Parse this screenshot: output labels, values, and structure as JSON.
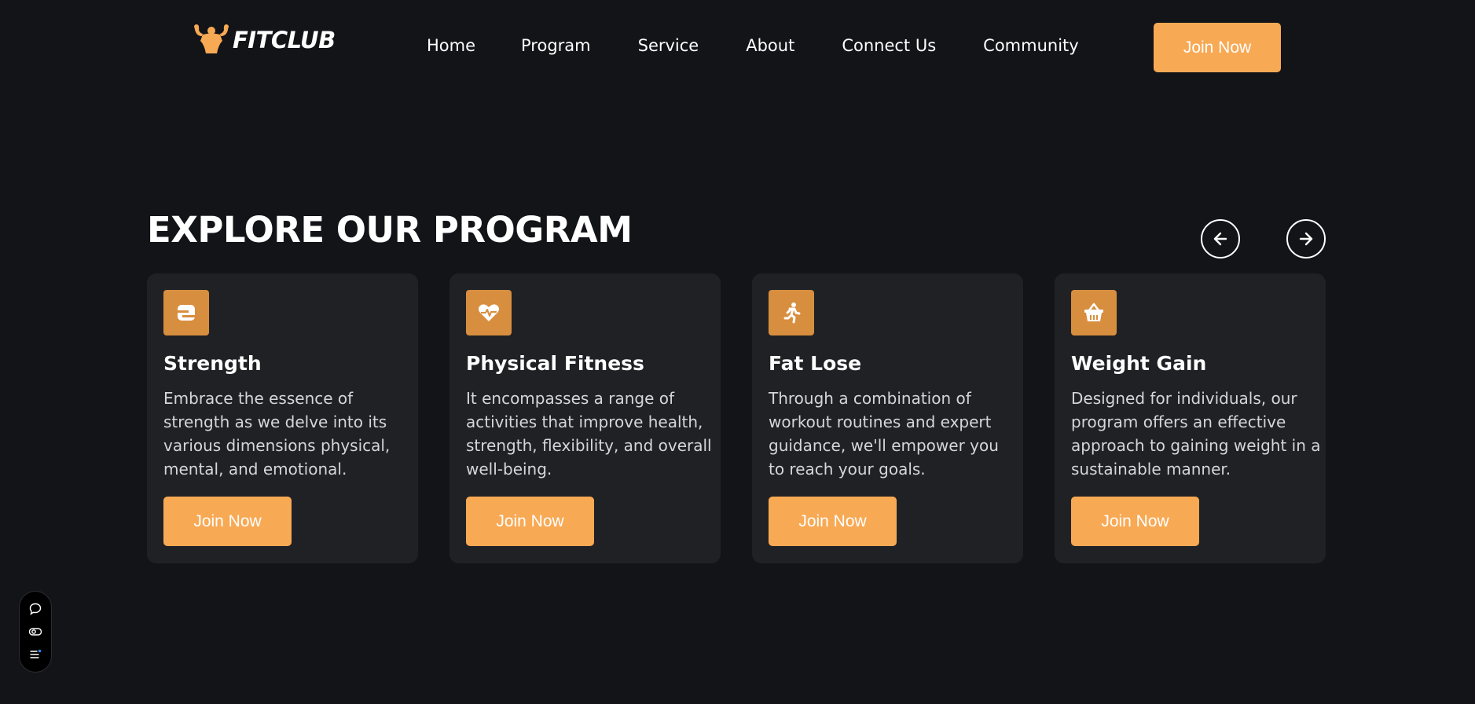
{
  "brand": {
    "logo_text": "FITCLUB",
    "accent_color": "#f8a954",
    "icon_bg_color": "#d78e3f",
    "logo_icon": "flexing-bodybuilder-icon"
  },
  "nav": {
    "items": [
      {
        "label": "Home"
      },
      {
        "label": "Program"
      },
      {
        "label": "Service"
      },
      {
        "label": "About"
      },
      {
        "label": "Connect Us"
      },
      {
        "label": "Community"
      }
    ],
    "cta_label": "Join Now"
  },
  "section": {
    "title": "EXPLORE OUR PROGRAM",
    "prev_icon": "arrow-left-icon",
    "next_icon": "arrow-right-icon"
  },
  "programs": [
    {
      "icon": "dumbbell-icon",
      "title": "Strength",
      "description": "Embrace the essence of strength as we delve into its various dimensions physical, mental, and emotional.",
      "button_label": "Join Now"
    },
    {
      "icon": "heart-pulse-icon",
      "title": "Physical Fitness",
      "description": "It encompasses a range of activities that improve health, strength, flexibility, and overall well-being.",
      "button_label": "Join Now"
    },
    {
      "icon": "running-person-icon",
      "title": "Fat Lose",
      "description": "Through a combination of workout routines and expert guidance, we'll empower you to reach your goals.",
      "button_label": "Join Now"
    },
    {
      "icon": "basket-icon",
      "title": "Weight Gain",
      "description": "Designed for individuals, our program offers an effective approach to gaining weight in a sustainable manner.",
      "button_label": "Join Now"
    }
  ],
  "floating_toolbar": {
    "icons": [
      "chat-bubble-icon",
      "toggle-icon",
      "menu-list-icon"
    ]
  }
}
